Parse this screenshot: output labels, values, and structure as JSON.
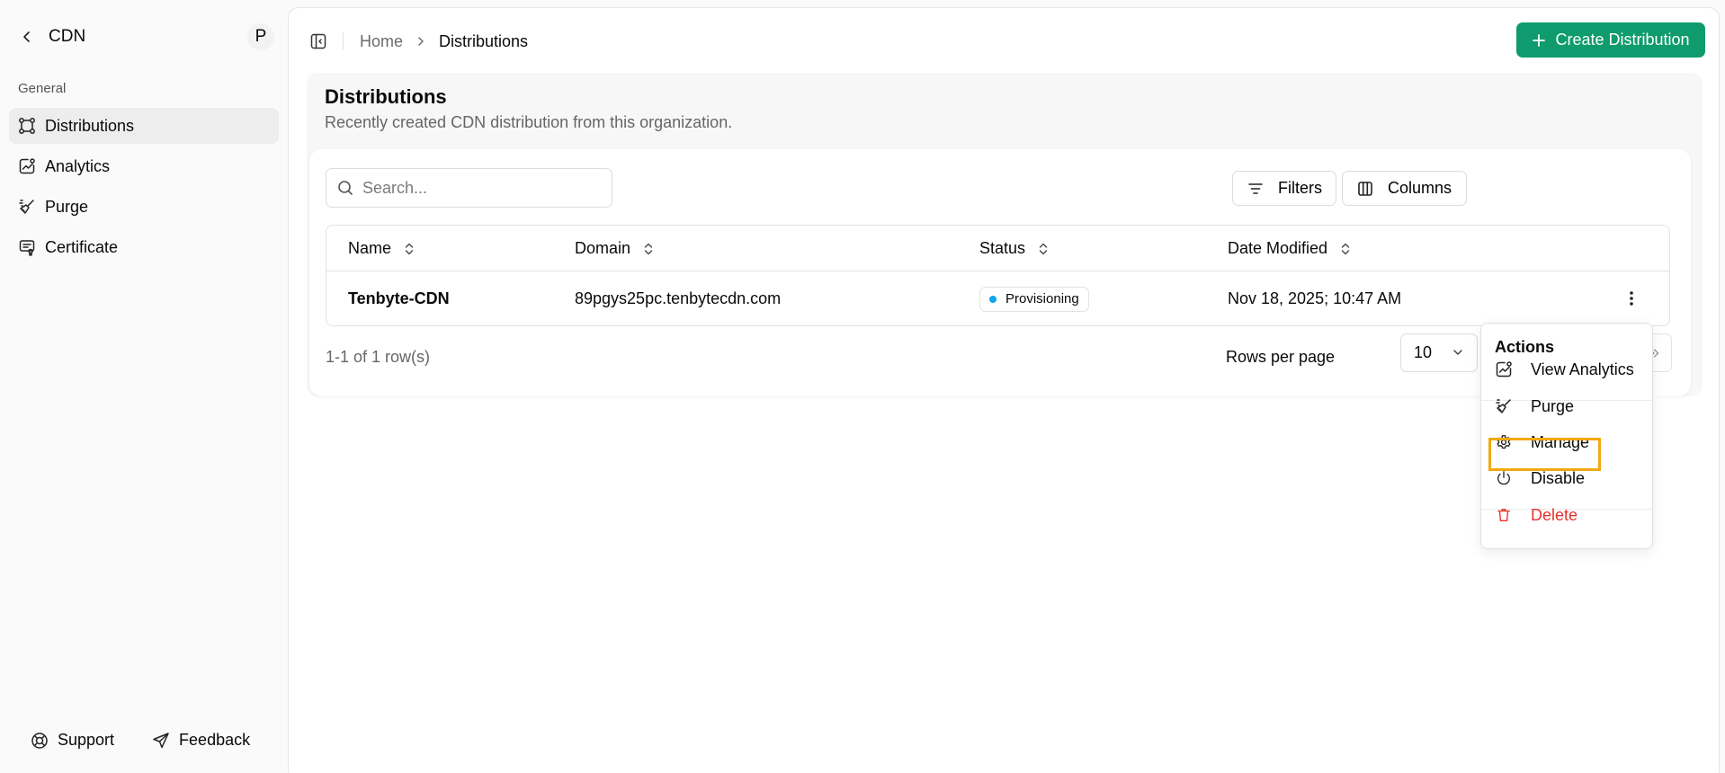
{
  "sidebar": {
    "title": "CDN",
    "avatar_initial": "P",
    "group_label": "General",
    "items": [
      {
        "label": "Distributions",
        "icon": "distributions-icon",
        "active": true
      },
      {
        "label": "Analytics",
        "icon": "analytics-icon",
        "active": false
      },
      {
        "label": "Purge",
        "icon": "purge-icon",
        "active": false
      },
      {
        "label": "Certificate",
        "icon": "certificate-icon",
        "active": false
      }
    ],
    "footer": {
      "support_label": "Support",
      "feedback_label": "Feedback"
    }
  },
  "header": {
    "breadcrumb_home": "Home",
    "breadcrumb_current": "Distributions",
    "create_button_label": "Create Distribution",
    "accent_color": "#0f9b6d"
  },
  "page": {
    "title": "Distributions",
    "subtitle": "Recently created CDN distribution from this organization."
  },
  "toolbar": {
    "search_placeholder": "Search...",
    "filters_label": "Filters",
    "columns_label": "Columns"
  },
  "table": {
    "columns": [
      "Name",
      "Domain",
      "Status",
      "Date Modified"
    ],
    "rows": [
      {
        "name": "Tenbyte-CDN",
        "domain": "89pgys25pc.tenbytecdn.com",
        "status": "Provisioning",
        "status_color": "#0ea5e9",
        "date_modified": "Nov 18, 2025; 10:47 AM"
      }
    ]
  },
  "pagination": {
    "row_count": "1-1 of 1 row(s)",
    "rows_per_page_label": "Rows per page",
    "rows_per_page_value": "10"
  },
  "actions_menu": {
    "title": "Actions",
    "items": [
      {
        "label": "View Analytics",
        "icon": "analytics-icon"
      },
      {
        "label": "Purge",
        "icon": "purge-icon"
      },
      {
        "label": "Manage",
        "icon": "gear-icon",
        "highlighted": true
      },
      {
        "label": "Disable",
        "icon": "power-icon"
      },
      {
        "label": "Delete",
        "icon": "trash-icon",
        "danger": true
      }
    ],
    "highlight_color": "#f0a911",
    "danger_color": "#e5322d"
  }
}
